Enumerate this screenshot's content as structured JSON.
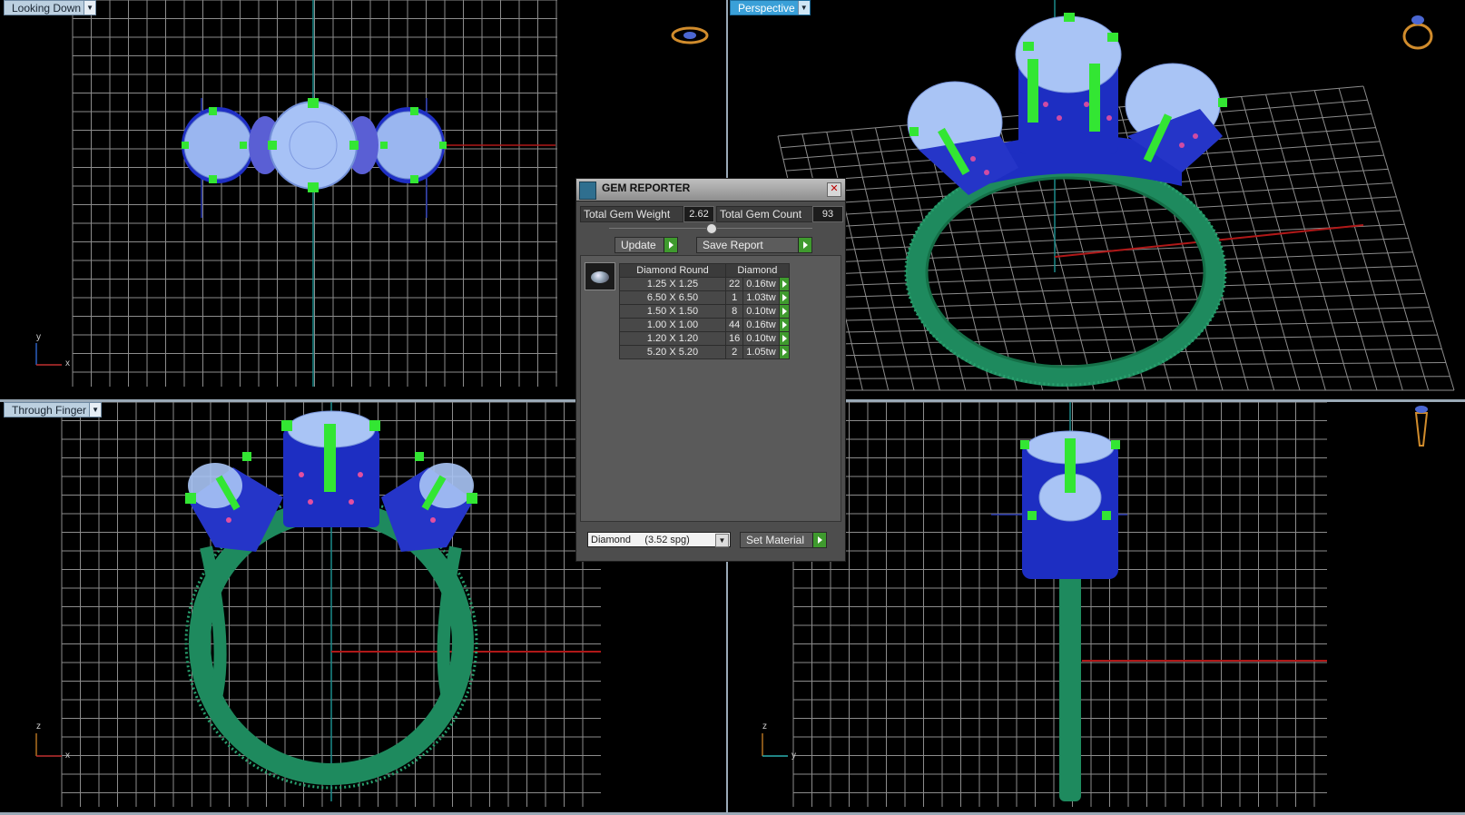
{
  "viewports": {
    "top_left": {
      "label": "Looking Down",
      "axis_a": "y",
      "axis_b": "x"
    },
    "top_right": {
      "label": "Perspective"
    },
    "bottom_left": {
      "label": "Through Finger",
      "axis_a": "z",
      "axis_b": "x"
    },
    "bottom_right": {
      "axis_a": "z",
      "axis_b": "y"
    }
  },
  "colors": {
    "metal": "#1e8a5e",
    "gem": "#a9c4f5",
    "setting": "#2233cc",
    "prong": "#33e633",
    "grid": "#9a9a9a",
    "active_label": "#3aa0d8"
  },
  "gem_reporter": {
    "title": "GEM REPORTER",
    "total_weight_label": "Total Gem Weight",
    "total_weight_value": "2.62",
    "total_count_label": "Total Gem Count",
    "total_count_value": "93",
    "update_label": "Update",
    "save_label": "Save Report",
    "table": {
      "headers": [
        "Diamond Round",
        "Diamond"
      ],
      "rows": [
        {
          "size": "1.25 X 1.25",
          "count": "22",
          "weight": "0.16tw"
        },
        {
          "size": "6.50 X 6.50",
          "count": "1",
          "weight": "1.03tw"
        },
        {
          "size": "1.50 X 1.50",
          "count": "8",
          "weight": "0.10tw"
        },
        {
          "size": "1.00 X 1.00",
          "count": "44",
          "weight": "0.16tw"
        },
        {
          "size": "1.20 X 1.20",
          "count": "16",
          "weight": "0.10tw"
        },
        {
          "size": "5.20 X 5.20",
          "count": "2",
          "weight": "1.05tw"
        }
      ]
    },
    "material_value": "Diamond     (3.52 spg)",
    "set_material_label": "Set Material"
  },
  "icons": [
    "ring-top-icon",
    "ring-perspective-icon",
    "ring-side-icon",
    "close-icon",
    "gem-reporter-icon",
    "dropdown-arrow-icon"
  ]
}
